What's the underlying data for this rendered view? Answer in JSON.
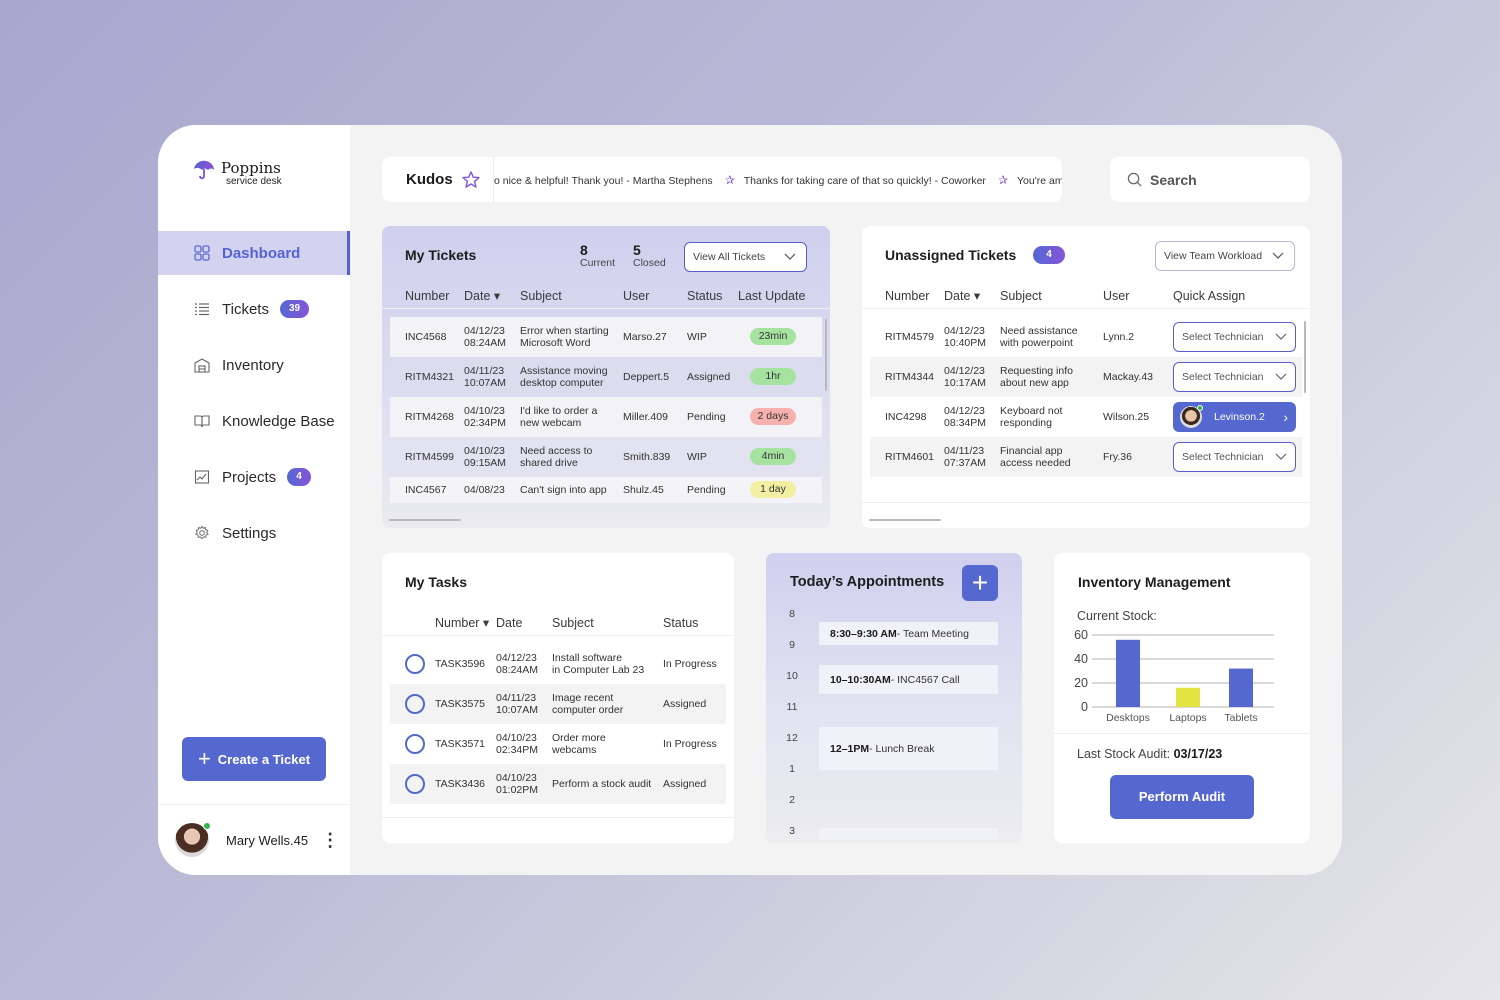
{
  "brand": {
    "name": "Poppins",
    "subtitle": "service desk"
  },
  "sidebar": {
    "items": [
      {
        "label": "Dashboard",
        "icon": "grid-icon",
        "active": true
      },
      {
        "label": "Tickets",
        "icon": "list-icon",
        "badge": "39"
      },
      {
        "label": "Inventory",
        "icon": "warehouse-icon"
      },
      {
        "label": "Knowledge Base",
        "icon": "book-icon"
      },
      {
        "label": "Projects",
        "icon": "chart-image-icon",
        "badge": "4"
      },
      {
        "label": "Settings",
        "icon": "gear-icon"
      }
    ],
    "create_button": "Create a Ticket",
    "user": {
      "name": "Mary Wells.45",
      "status": "online"
    }
  },
  "kudos": {
    "label": "Kudos",
    "messages": [
      "o nice & helpful!  Thank you! - Martha Stephens",
      "Thanks for taking care of that so quickly! - Coworker",
      "You're amaz"
    ]
  },
  "search": {
    "placeholder": "Search"
  },
  "my_tickets": {
    "title": "My Tickets",
    "current_count": "8",
    "current_label": "Current",
    "closed_count": "5",
    "closed_label": "Closed",
    "view_dropdown": "View All Tickets",
    "columns": [
      "Number",
      "Date ▾",
      "Subject",
      "User",
      "Status",
      "Last Update"
    ],
    "rows": [
      {
        "number": "INC4568",
        "date": "04/12/23",
        "time": "08:24AM",
        "subject1": "Error when starting",
        "subject2": "Microsoft Word",
        "user": "Marso.27",
        "status": "WIP",
        "update": "23min",
        "update_color": "#a6e3a1"
      },
      {
        "number": "RITM4321",
        "date": "04/11/23",
        "time": "10:07AM",
        "subject1": "Assistance moving",
        "subject2": "desktop computer",
        "user": "Deppert.5",
        "status": "Assigned",
        "update": "1hr",
        "update_color": "#a6e3a1"
      },
      {
        "number": "RITM4268",
        "date": "04/10/23",
        "time": "02:34PM",
        "subject1": "I'd like to order a",
        "subject2": "new webcam",
        "user": "Miller.409",
        "status": "Pending",
        "update": "2 days",
        "update_color": "#f6b0ad"
      },
      {
        "number": "RITM4599",
        "date": "04/10/23",
        "time": "09:15AM",
        "subject1": "Need access to",
        "subject2": "shared drive",
        "user": "Smith.839",
        "status": "WIP",
        "update": "4min",
        "update_color": "#a6e3a1"
      },
      {
        "number": "INC4567",
        "date": "04/08/23",
        "time": "",
        "subject1": "Can't sign into app",
        "subject2": "",
        "user": "Shulz.45",
        "status": "Pending",
        "update": "1 day",
        "update_color": "#f3efa2"
      }
    ]
  },
  "unassigned": {
    "title": "Unassigned Tickets",
    "count": "4",
    "view_dropdown": "View Team Workload",
    "columns": [
      "Number",
      "Date ▾",
      "Subject",
      "User",
      "Quick Assign"
    ],
    "select_placeholder": "Select Technician",
    "rows": [
      {
        "number": "RITM4579",
        "date": "04/12/23",
        "time": "10:40PM",
        "subject1": "Need assistance",
        "subject2": "with powerpoint",
        "user": "Lynn.2",
        "assigned": ""
      },
      {
        "number": "RITM4344",
        "date": "04/12/23",
        "time": "10:17AM",
        "subject1": "Requesting info",
        "subject2": "about new app",
        "user": "Mackay.43",
        "assigned": ""
      },
      {
        "number": "INC4298",
        "date": "04/12/23",
        "time": "08:34PM",
        "subject1": "Keyboard not",
        "subject2": "responding",
        "user": "Wilson.25",
        "assigned": "Levinson.2"
      },
      {
        "number": "RITM4601",
        "date": "04/11/23",
        "time": "07:37AM",
        "subject1": "Financial app",
        "subject2": "access needed",
        "user": "Fry.36",
        "assigned": ""
      }
    ]
  },
  "tasks": {
    "title": "My Tasks",
    "columns": [
      "Number ▾",
      "Date",
      "Subject",
      "Status"
    ],
    "rows": [
      {
        "number": "TASK3596",
        "date": "04/12/23",
        "time": "08:24AM",
        "subject1": "Install software",
        "subject2": "in Computer Lab 23",
        "status": "In Progress"
      },
      {
        "number": "TASK3575",
        "date": "04/11/23",
        "time": "10:07AM",
        "subject1": "Image recent",
        "subject2": "computer order",
        "status": "Assigned"
      },
      {
        "number": "TASK3571",
        "date": "04/10/23",
        "time": "02:34PM",
        "subject1": "Order more",
        "subject2": "webcams",
        "status": "In Progress"
      },
      {
        "number": "TASK3436",
        "date": "04/10/23",
        "time": "01:02PM",
        "subject1": "Perform a stock audit",
        "subject2": "",
        "status": "Assigned"
      }
    ]
  },
  "appointments": {
    "title": "Today’s Appointments",
    "hours": [
      "8",
      "9",
      "10",
      "11",
      "12",
      "1",
      "2",
      "3"
    ],
    "items": [
      {
        "time": "8:30–9:30 AM",
        "title": " - Team Meeting"
      },
      {
        "time": "10–10:30AM",
        "title": " - INC4567 Call"
      },
      {
        "time": "12–1PM",
        "title": " - Lunch Break"
      }
    ]
  },
  "inventory": {
    "title": "Inventory Management",
    "last_audit_label": "Last Stock Audit: ",
    "last_audit_date": "03/17/23",
    "audit_button": "Perform Audit"
  },
  "chart_data": {
    "type": "bar",
    "title": "Current Stock:",
    "categories": [
      "Desktops",
      "Laptops",
      "Tablets"
    ],
    "values": [
      56,
      16,
      32
    ],
    "colors": [
      "#5468d0",
      "#e3e342",
      "#5468d0"
    ],
    "xlabel": "",
    "ylabel": "",
    "ylim": [
      0,
      60
    ],
    "yticks": [
      0,
      20,
      40,
      60
    ],
    "grid": true
  },
  "colors": {
    "accent": "#5468d0",
    "active_nav_bg": "#d3d3f0",
    "online": "#34b34f"
  }
}
